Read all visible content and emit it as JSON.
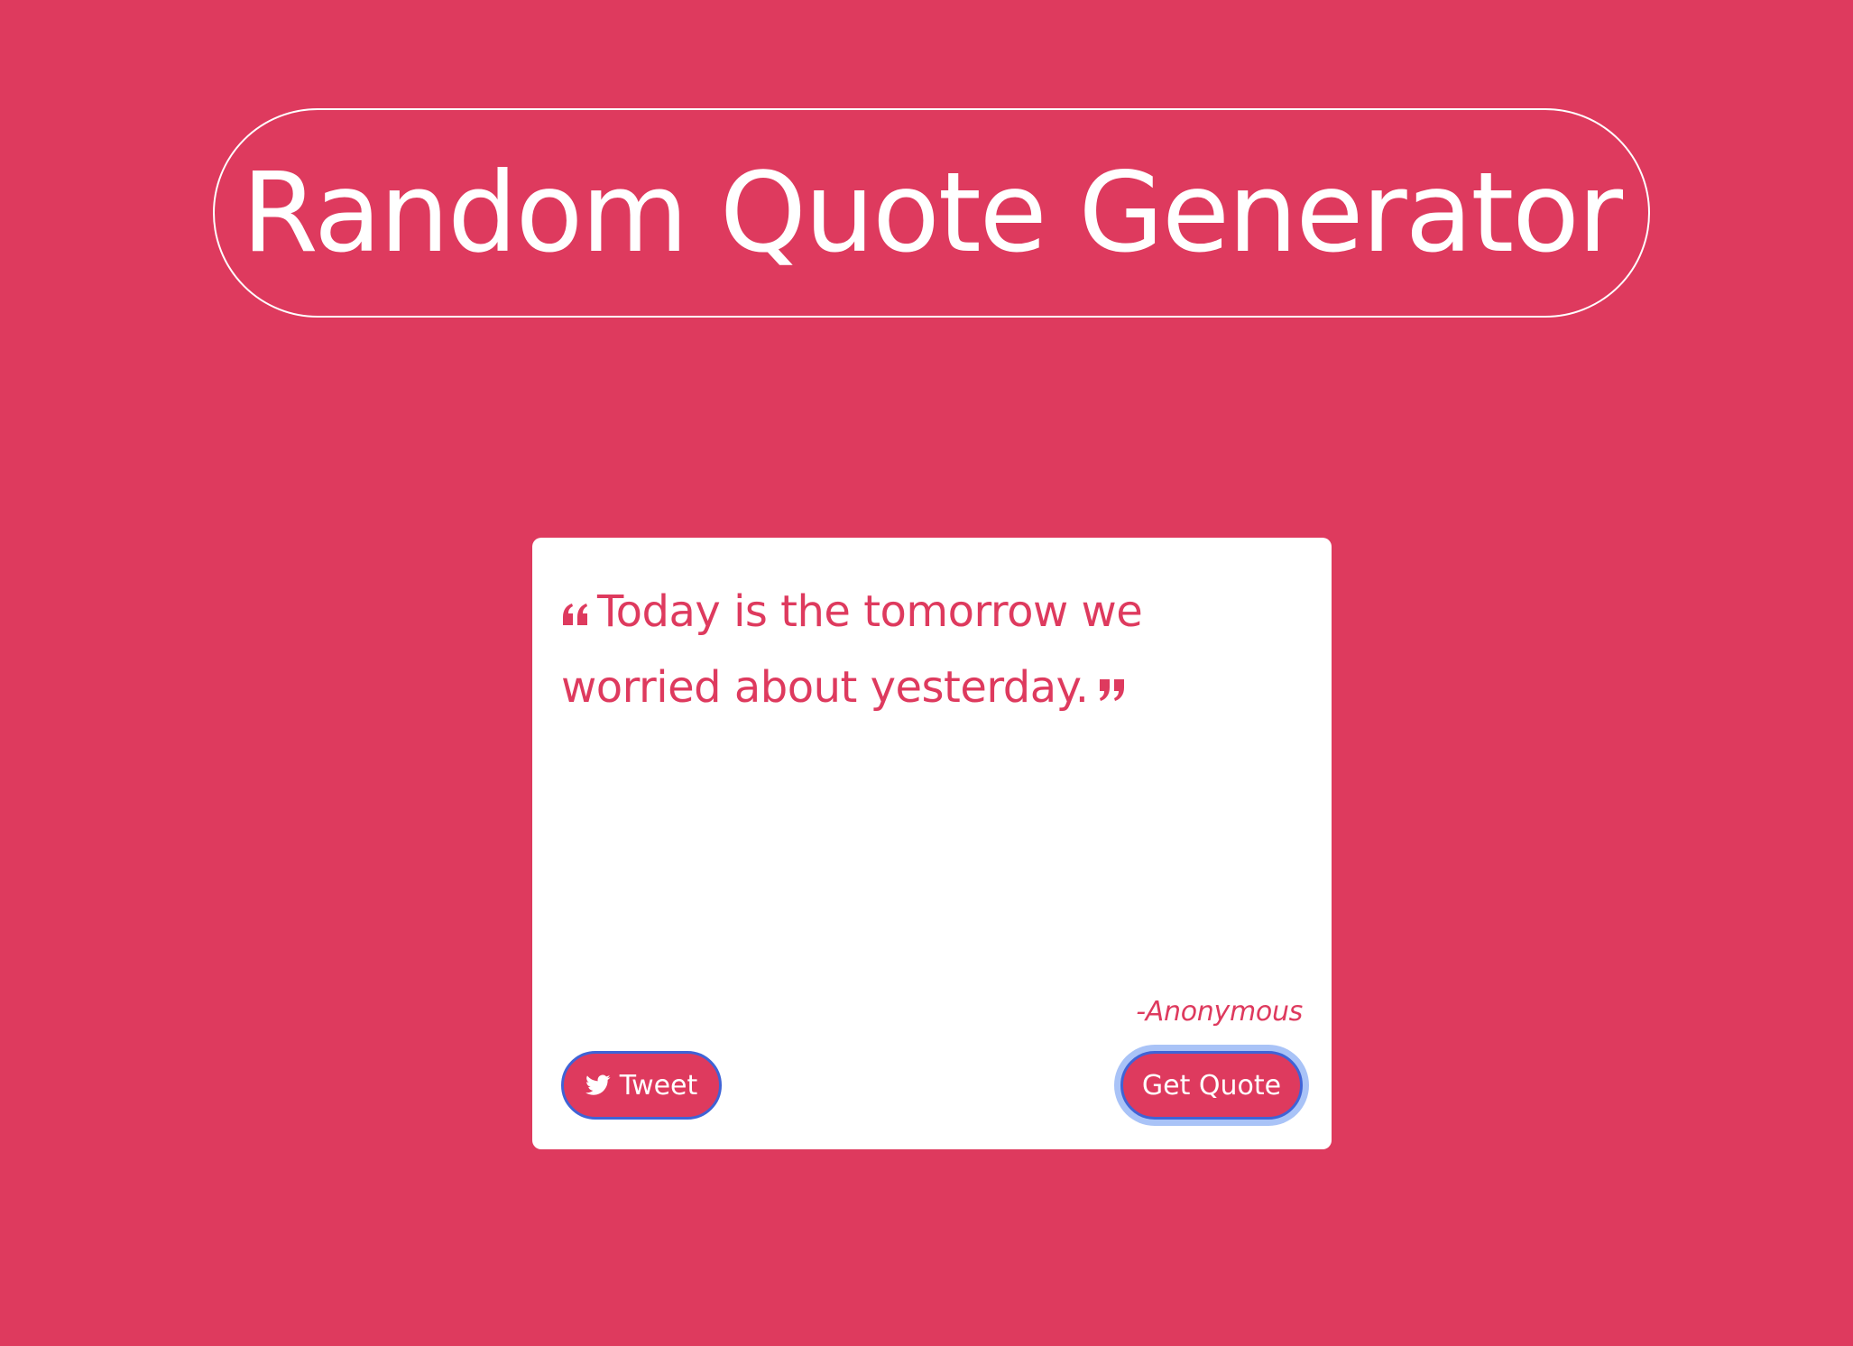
{
  "header": {
    "title": "Random Quote Generator"
  },
  "quote": {
    "text": "Today is the tomorrow we worried about yesterday.",
    "author": "-Anonymous"
  },
  "actions": {
    "tweet_label": "Tweet",
    "new_quote_label": "Get Quote"
  },
  "icons": {
    "open_quote": "quote-left-icon",
    "close_quote": "quote-right-icon",
    "tweet": "twitter-icon"
  },
  "colors": {
    "background": "#de3a5e",
    "card": "#ffffff",
    "accent_text": "#de3a5e",
    "button_border": "#3f63d6",
    "focus_ring": "#a9c3f7"
  }
}
